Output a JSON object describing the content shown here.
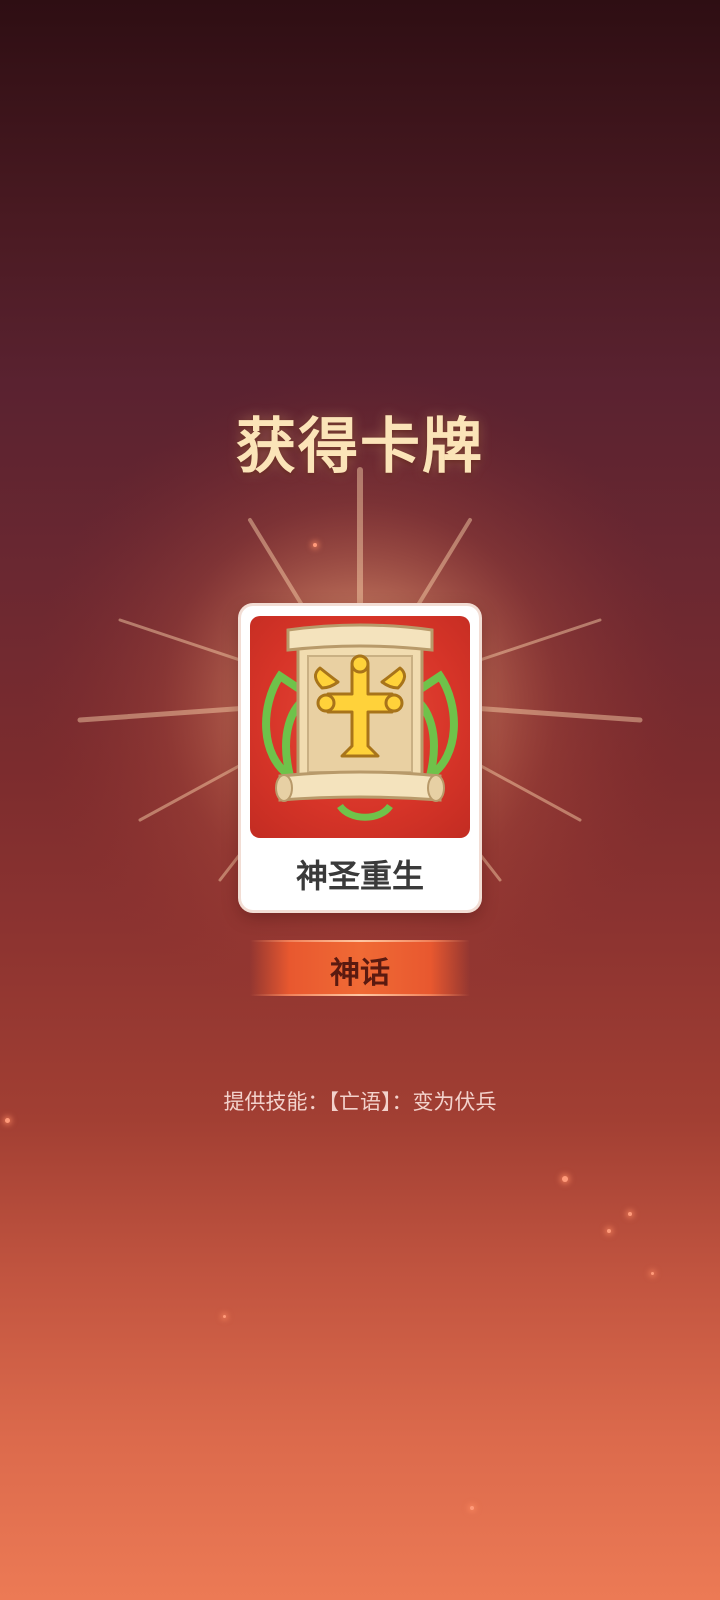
{
  "title": "获得卡牌",
  "card": {
    "name": "神圣重生",
    "icon": "holy-scroll-cross-icon",
    "art_bg_color": "#d63428"
  },
  "rarity": {
    "label": "神话",
    "color": "#f06a35"
  },
  "skill_text": "提供技能：【亡语】：变为伏兵"
}
